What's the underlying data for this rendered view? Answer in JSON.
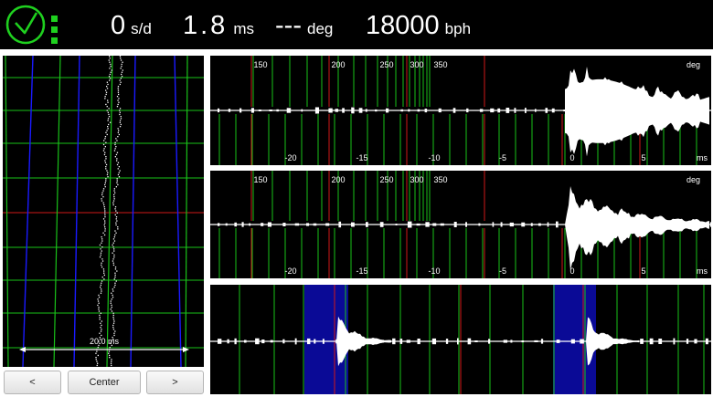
{
  "readouts": {
    "rate": {
      "value": "0",
      "unit": "s/d"
    },
    "beat_error": {
      "value": "1.8",
      "unit": "ms"
    },
    "amplitude": {
      "value": "---",
      "unit": "deg"
    },
    "beat_rate": {
      "value": "18000",
      "unit": "bph"
    }
  },
  "paper_strip": {
    "scale_label": "20.0 ms"
  },
  "waveforms": {
    "degree_ticks": [
      "150",
      "200",
      "250",
      "300",
      "350"
    ],
    "degree_unit": "deg",
    "time_ticks": [
      "-20",
      "-15",
      "-10",
      "-5",
      "0",
      "5"
    ],
    "time_unit": "ms"
  },
  "buttons": {
    "prev": "<",
    "center": "Center",
    "next": ">"
  },
  "colors": {
    "ok_green": "#1fd01f",
    "grid_green": "#19c219",
    "marker_red": "#d01818",
    "paper_blue": "#1a1aff",
    "highlight_blue": "#0a0a96"
  },
  "icons": {
    "status": "clock-check-icon",
    "indicator": "signal-dots-icon"
  }
}
